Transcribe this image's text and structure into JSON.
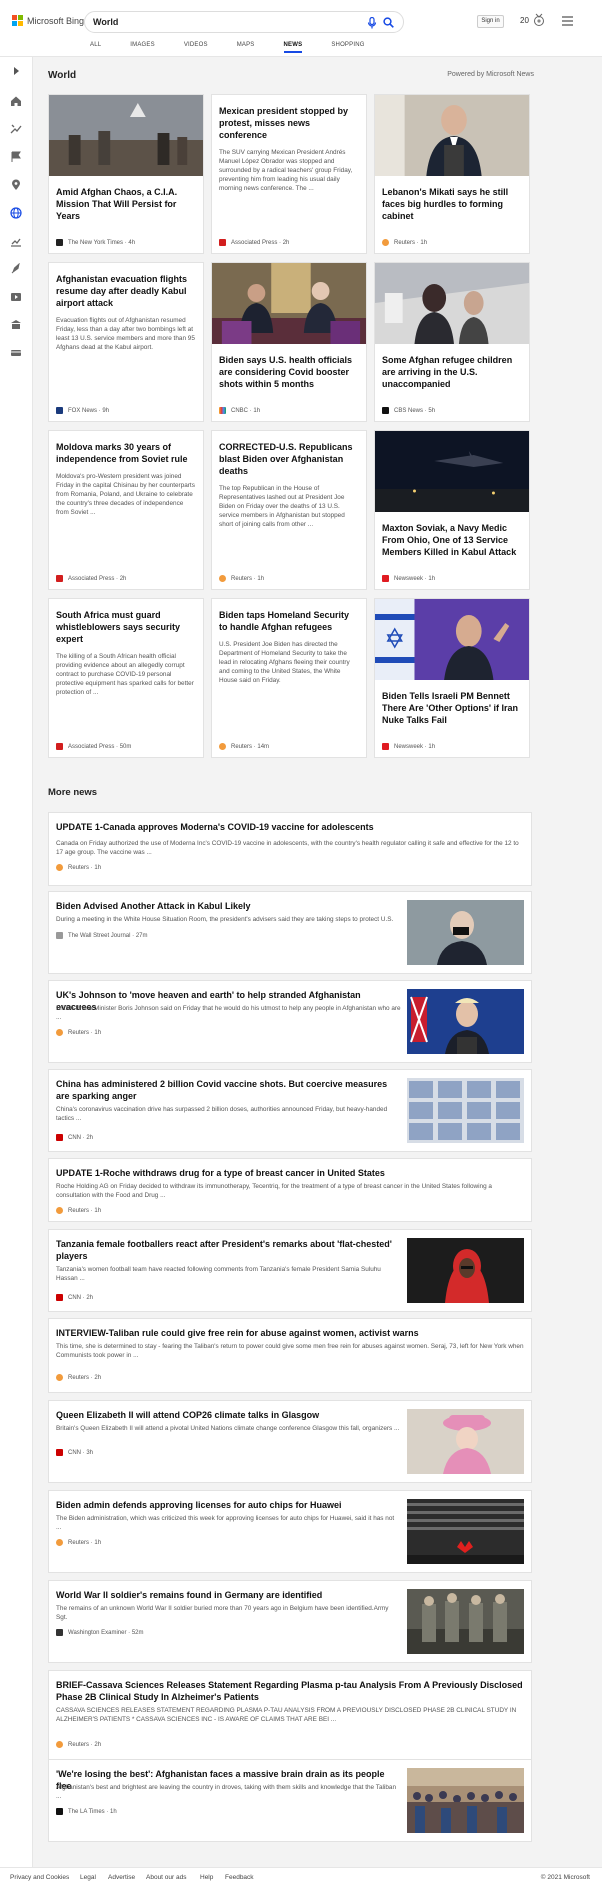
{
  "header": {
    "logo_text": "Microsoft Bing",
    "search_value": "World",
    "signin_label": "Sign in",
    "rewards_count": "20",
    "tabs": [
      {
        "label": "ALL"
      },
      {
        "label": "IMAGES"
      },
      {
        "label": "VIDEOS"
      },
      {
        "label": "MAPS"
      },
      {
        "label": "NEWS"
      },
      {
        "label": "SHOPPING"
      }
    ],
    "active_tab": "NEWS"
  },
  "main": {
    "section_title": "World",
    "powered_by": "Powered by Microsoft News",
    "cards": [
      {
        "title": "Amid Afghan Chaos, a C.I.A. Mission That Will Persist for Years",
        "desc": "",
        "source": "The New York Times",
        "time": "4h"
      },
      {
        "title": "Mexican president stopped by protest, misses news conference",
        "desc": "The SUV carrying Mexican President Andrés Manuel López Obrador was stopped and surrounded by a radical teachers' group Friday, preventing him from leading his usual daily morning news conference. The ...",
        "source": "Associated Press",
        "time": "2h"
      },
      {
        "title": "Lebanon's Mikati says he still faces big hurdles to forming cabinet",
        "desc": "",
        "source": "Reuters",
        "time": "1h"
      },
      {
        "title": "Afghanistan evacuation flights resume day after deadly Kabul airport attack",
        "desc": "Evacuation flights out of Afghanistan resumed Friday, less than a day after two bombings left at least 13 U.S. service members and more than 95 Afghans dead at the Kabul airport.",
        "source": "FOX News",
        "time": "9h"
      },
      {
        "title": "Biden says U.S. health officials are considering Covid booster shots within 5 months",
        "desc": "",
        "source": "CNBC",
        "time": "1h"
      },
      {
        "title": "Some Afghan refugee children are arriving in the U.S. unaccompanied",
        "desc": "",
        "source": "CBS News",
        "time": "5h"
      },
      {
        "title": "Moldova marks 30 years of independence from Soviet rule",
        "desc": "Moldova's pro-Western president was joined Friday in the capital Chisinau by her counterparts from Romania, Poland, and Ukraine to celebrate the country's three decades of independence from Soviet ...",
        "source": "Associated Press",
        "time": "2h"
      },
      {
        "title": "CORRECTED-U.S. Republicans blast Biden over Afghanistan deaths",
        "desc": "The top Republican in the House of Representatives lashed out at President Joe Biden on Friday over the deaths of 13 U.S. service members in Afghanistan but stopped short of joining calls from other ...",
        "source": "Reuters",
        "time": "1h"
      },
      {
        "title": "Maxton Soviak, a Navy Medic From Ohio, One of 13 Service Members Killed in Kabul Attack",
        "desc": "",
        "source": "Newsweek",
        "time": "1h"
      },
      {
        "title": "South Africa must guard whistleblowers says security expert",
        "desc": "The killing of a South African health official providing evidence about an allegedly corrupt contract to purchase COVID-19 personal protective equipment has sparked calls for better protection of ...",
        "source": "Associated Press",
        "time": "50m"
      },
      {
        "title": "Biden taps Homeland Security to handle Afghan refugees",
        "desc": "U.S. President Joe Biden has directed the Department of Homeland Security to take the lead in relocating Afghans fleeing their country and coming to the United States, the White House said on Friday.",
        "source": "Reuters",
        "time": "14m"
      },
      {
        "title": "Biden Tells Israeli PM Bennett There Are 'Other Options' if Iran Nuke Talks Fail",
        "desc": "",
        "source": "Newsweek",
        "time": "1h"
      }
    ],
    "more_title": "More news",
    "more": [
      {
        "title": "UPDATE 1-Canada approves Moderna's COVID-19 vaccine for adolescents",
        "desc": "Canada on Friday authorized the use of Moderna Inc's COVID-19 vaccine in adolescents, with the country's health regulator calling it safe and effective for the 12 to 17 age group. The vaccine was ...",
        "source": "Reuters",
        "time": "1h"
      },
      {
        "title": "Biden Advised Another Attack in Kabul Likely",
        "desc": "During a meeting in the White House Situation Room, the president's advisers said they are taking steps to protect U.S.",
        "source": "The Wall Street Journal",
        "time": "27m"
      },
      {
        "title": "UK's Johnson to 'move heaven and earth' to help stranded Afghanistan evacuees",
        "desc": "British Prime Minister Boris Johnson said on Friday that he would do his utmost to help any people in Afghanistan who are ...",
        "source": "Reuters",
        "time": "1h"
      },
      {
        "title": "China has administered 2 billion Covid vaccine shots. But coercive measures are sparking anger",
        "desc": "China's coronavirus vaccination drive has surpassed 2 billion doses, authorities announced Friday, but heavy-handed tactics ...",
        "source": "CNN",
        "time": "2h"
      },
      {
        "title": "UPDATE 1-Roche withdraws drug for a type of breast cancer in United States",
        "desc": "Roche Holding AG on Friday decided to withdraw its immunotherapy, Tecentriq, for the treatment of a type of breast cancer in the United States following a consultation with the Food and Drug ...",
        "source": "Reuters",
        "time": "1h"
      },
      {
        "title": "Tanzania female footballers react after President's remarks about 'flat-chested' players",
        "desc": "Tanzania's women football team have reacted following comments from Tanzania's female President Samia Suluhu Hassan ...",
        "source": "CNN",
        "time": "2h"
      },
      {
        "title": "INTERVIEW-Taliban rule could give free rein for abuse against women, activist warns",
        "desc": "This time, she is determined to stay - fearing the Taliban's return to power could give some men free rein for abuses against women. Seraj, 73, left for New York when Communists took power in ...",
        "source": "Reuters",
        "time": "2h"
      },
      {
        "title": "Queen Elizabeth II will attend COP26 climate talks in Glasgow",
        "desc": "Britain's Queen Elizabeth II will attend a pivotal United Nations climate change conference Glasgow this fall, organizers ...",
        "source": "CNN",
        "time": "3h"
      },
      {
        "title": "Biden admin defends approving licenses for auto chips for Huawei",
        "desc": "The Biden administration, which was criticized this week for approving licenses for auto chips for Huawei, said it has not ...",
        "source": "Reuters",
        "time": "1h"
      },
      {
        "title": "World War II soldier's remains found in Germany are identified",
        "desc": "The remains of an unknown World War II soldier buried more than 70 years ago in Belgium have been identified.Army Sgt.",
        "source": "Washington Examiner",
        "time": "52m"
      },
      {
        "title": "BRIEF-Cassava Sciences Releases Statement Regarding Plasma p-tau Analysis From A Previously Disclosed Phase 2B Clinical Study In Alzheimer's Patients",
        "desc": "CASSAVA SCIENCES RELEASES STATEMENT REGARDING PLASMA P-TAU ANALYSIS FROM A PREVIOUSLY DISCLOSED PHASE 2B CLINICAL STUDY IN ALZHEIMER'S PATIENTS * CASSAVA SCIENCES INC - IS AWARE OF CLAIMS THAT ARE BEI ...",
        "source": "Reuters",
        "time": "2h"
      },
      {
        "title": "'We're losing the best': Afghanistan faces a massive brain drain as its people flee",
        "desc": "Afghanistan's best and brightest are leaving the country in droves, taking with them skills and knowledge that the Taliban ...",
        "source": "The LA Times",
        "time": "1h"
      }
    ]
  },
  "footer": {
    "links": [
      "Privacy and Cookies",
      "Legal",
      "Advertise",
      "About our ads",
      "Help",
      "Feedback"
    ],
    "copyright": "© 2021 Microsoft"
  },
  "colors": {
    "accent": "#174ae4",
    "ap": "#d21e1e",
    "reuters": "#f29b3c",
    "cnn": "#cc0000",
    "newsweek": "#e01b22"
  }
}
